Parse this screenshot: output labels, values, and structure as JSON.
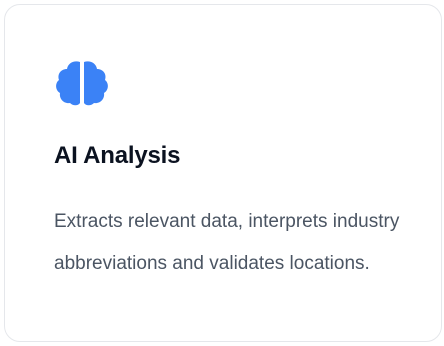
{
  "card": {
    "icon": "brain-icon",
    "icon_color": "#3b82f6",
    "title": "AI Analysis",
    "description": "Extracts relevant data, interprets industry abbreviations and validates locations."
  }
}
